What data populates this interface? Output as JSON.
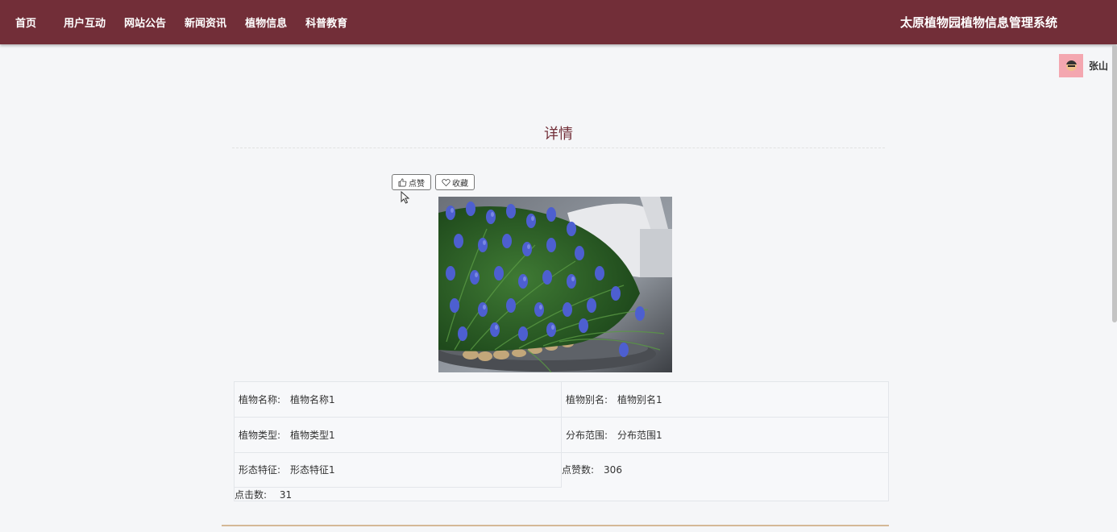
{
  "nav": {
    "items": [
      "首页",
      "用户互动",
      "网站公告",
      "新闻资讯",
      "植物信息",
      "科普教育"
    ]
  },
  "site_title": "太原植物园植物信息管理系统",
  "user": {
    "name": "张山"
  },
  "detail": {
    "title": "详情",
    "like_label": "点赞",
    "favorite_label": "收藏"
  },
  "info": {
    "plant_name_label": "植物名称:",
    "plant_name_value": "植物名称1",
    "alias_label": "植物别名:",
    "alias_value": "植物别名1",
    "type_label": "植物类型:",
    "type_value": "植物类型1",
    "range_label": "分布范围:",
    "range_value": "分布范围1",
    "feature_label": "形态特征:",
    "feature_value": "形态特征1",
    "likes_label": "点赞数:",
    "likes_value": "306",
    "clicks_label": "点击数:",
    "clicks_value": "31"
  },
  "colors": {
    "brand": "#722e38",
    "accent_line": "#d4b896"
  }
}
